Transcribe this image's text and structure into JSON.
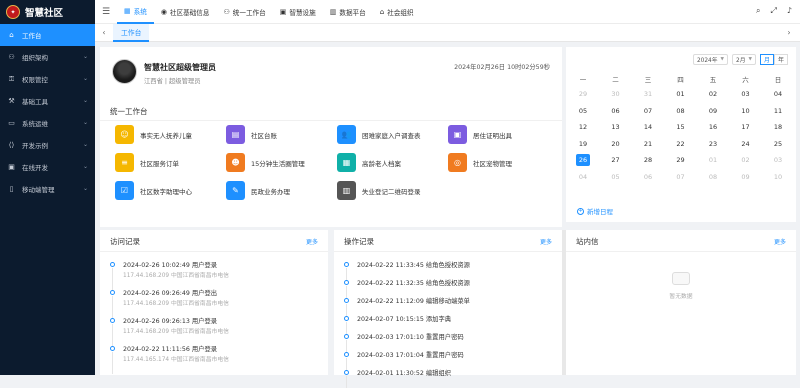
{
  "app": {
    "title": "智慧社区"
  },
  "sidebar": {
    "items": [
      {
        "label": "工作台",
        "icon": "home-icon",
        "active": true
      },
      {
        "label": "组织架构",
        "icon": "org-icon"
      },
      {
        "label": "权限管控",
        "icon": "key-icon"
      },
      {
        "label": "基础工具",
        "icon": "tool-icon"
      },
      {
        "label": "系统运维",
        "icon": "monitor-icon"
      },
      {
        "label": "开发示例",
        "icon": "code-icon"
      },
      {
        "label": "在线开发",
        "icon": "dev-icon"
      },
      {
        "label": "移动端管理",
        "icon": "mobile-icon"
      }
    ]
  },
  "topmenu": {
    "items": [
      {
        "label": "系统",
        "active": true
      },
      {
        "label": "社区基础信息"
      },
      {
        "label": "统一工作台"
      },
      {
        "label": "智慧设施"
      },
      {
        "label": "数据平台"
      },
      {
        "label": "社会组织"
      }
    ]
  },
  "tabs": {
    "items": [
      {
        "label": "工作台"
      }
    ]
  },
  "user": {
    "name": "智慧社区超级管理员",
    "sub": "江西省 | 超级管理员",
    "datetime": "2024年02月26日 10时02分59秒"
  },
  "workbench": {
    "title": "统一工作台",
    "items": [
      {
        "label": "事实无人抚养儿童",
        "color": "#f5b700",
        "icon": "smile-icon",
        "glyph": "☺"
      },
      {
        "label": "社区台账",
        "color": "#7c5ce0",
        "icon": "ledger-icon",
        "glyph": "▤"
      },
      {
        "label": "困难家庭入户调查表",
        "color": "#1e90ff",
        "icon": "users-icon",
        "glyph": "👥"
      },
      {
        "label": "居住证明出具",
        "color": "#7c5ce0",
        "icon": "certificate-icon",
        "glyph": "▣"
      },
      {
        "label": "社区服务订单",
        "color": "#f5b700",
        "icon": "list-icon",
        "glyph": "≡"
      },
      {
        "label": "15分钟生活圈管理",
        "color": "#f07b20",
        "icon": "person-icon",
        "glyph": "☻"
      },
      {
        "label": "高龄老人档案",
        "color": "#10b0a8",
        "icon": "archive-icon",
        "glyph": "▦"
      },
      {
        "label": "社区宠物管理",
        "color": "#f07b20",
        "icon": "headset-icon",
        "glyph": "◎"
      },
      {
        "label": "社区数字助理中心",
        "color": "#1e90ff",
        "icon": "calendar-check-icon",
        "glyph": "☑"
      },
      {
        "label": "民政业务办理",
        "color": "#1e90ff",
        "icon": "pen-icon",
        "glyph": "✎"
      },
      {
        "label": "失业登记二维码登录",
        "color": "#555555",
        "icon": "barcode-icon",
        "glyph": "▥"
      }
    ]
  },
  "calendar": {
    "year": "2024年",
    "month": "2月",
    "btn_month": "月",
    "btn_year": "年",
    "weekdays": [
      "一",
      "二",
      "三",
      "四",
      "五",
      "六",
      "日"
    ],
    "rows": [
      [
        "29",
        "30",
        "31",
        "01",
        "02",
        "03",
        "04"
      ],
      [
        "05",
        "06",
        "07",
        "08",
        "09",
        "10",
        "11"
      ],
      [
        "12",
        "13",
        "14",
        "15",
        "16",
        "17",
        "18"
      ],
      [
        "19",
        "20",
        "21",
        "22",
        "23",
        "24",
        "25"
      ],
      [
        "26",
        "27",
        "28",
        "29",
        "01",
        "02",
        "03"
      ],
      [
        "04",
        "05",
        "06",
        "07",
        "08",
        "09",
        "10"
      ]
    ],
    "new_schedule": "新增日程"
  },
  "visits": {
    "title": "访问记录",
    "more": "更多",
    "items": [
      {
        "title": "2024-02-26 10:02:49 用户登录",
        "sub": "117.44.168.209 中国江西省南昌市电信"
      },
      {
        "title": "2024-02-26 09:26:49 用户登出",
        "sub": "117.44.168.209 中国江西省南昌市电信"
      },
      {
        "title": "2024-02-26 09:26:13 用户登录",
        "sub": "117.44.168.209 中国江西省南昌市电信"
      },
      {
        "title": "2024-02-22 11:11:56 用户登录",
        "sub": "117.44.165.174 中国江西省南昌市电信"
      }
    ]
  },
  "operations": {
    "title": "操作记录",
    "more": "更多",
    "items": [
      {
        "title": "2024-02-22 11:33:45 给角色授权资源"
      },
      {
        "title": "2024-02-22 11:32:35 给角色授权资源"
      },
      {
        "title": "2024-02-22 11:12:09 编辑移动端菜单"
      },
      {
        "title": "2024-02-07 10:15:15 添加字典"
      },
      {
        "title": "2024-02-03 17:01:10 重置用户密码"
      },
      {
        "title": "2024-02-03 17:01:04 重置用户密码"
      },
      {
        "title": "2024-02-01 11:30:52 编辑组织"
      }
    ]
  },
  "mail": {
    "title": "站内信",
    "more": "更多",
    "empty": "暂无数据"
  }
}
